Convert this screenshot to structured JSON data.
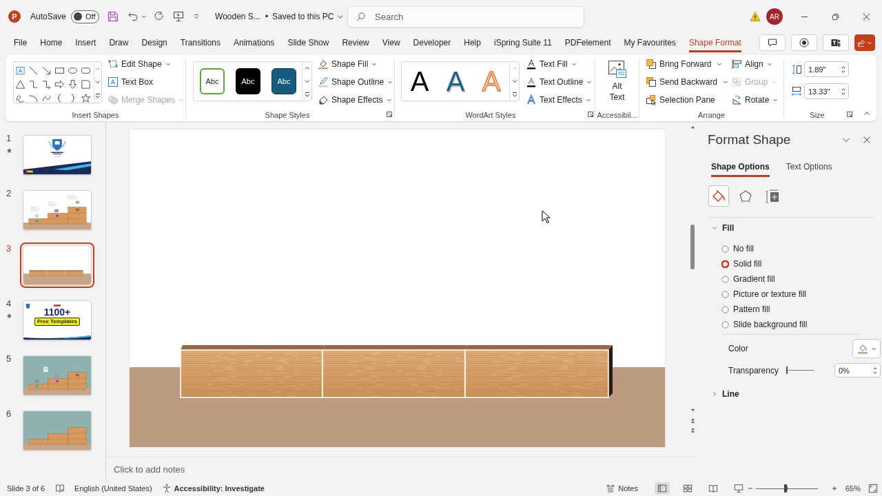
{
  "title_bar": {
    "app_logo": "P",
    "autosave": {
      "label": "AutoSave",
      "on": false,
      "state": "Off"
    },
    "document_name": "Wooden S...",
    "separator": "•",
    "save_status": "Saved to this PC",
    "search": {
      "placeholder": "Search"
    },
    "avatar": "AR"
  },
  "tabs": [
    {
      "label": "File",
      "selected": false
    },
    {
      "label": "Home",
      "selected": false
    },
    {
      "label": "Insert",
      "selected": false
    },
    {
      "label": "Draw",
      "selected": false
    },
    {
      "label": "Design",
      "selected": false
    },
    {
      "label": "Transitions",
      "selected": false
    },
    {
      "label": "Animations",
      "selected": false
    },
    {
      "label": "Slide Show",
      "selected": false
    },
    {
      "label": "Review",
      "selected": false
    },
    {
      "label": "View",
      "selected": false
    },
    {
      "label": "Developer",
      "selected": false
    },
    {
      "label": "Help",
      "selected": false
    },
    {
      "label": "iSpring Suite 11",
      "selected": false
    },
    {
      "label": "PDFelement",
      "selected": false
    },
    {
      "label": "My Favourites",
      "selected": false
    },
    {
      "label": "Shape Format",
      "selected": true
    }
  ],
  "ribbon": {
    "insert_shapes": {
      "label": "Insert Shapes",
      "commands": [
        {
          "label": "Edit Shape",
          "dropdown": true,
          "disabled": false
        },
        {
          "label": "Text Box",
          "dropdown": false,
          "disabled": false
        },
        {
          "label": "Merge Shapes",
          "dropdown": true,
          "disabled": true
        }
      ]
    },
    "shape_styles": {
      "label": "Shape Styles",
      "presets": [
        {
          "label": "Abc",
          "kind": "outline"
        },
        {
          "label": "Abc",
          "kind": "dark"
        },
        {
          "label": "Abc",
          "kind": "accent"
        }
      ],
      "commands": [
        {
          "label": "Shape Fill",
          "dropdown": true,
          "disabled": false
        },
        {
          "label": "Shape Outline",
          "dropdown": true,
          "disabled": false
        },
        {
          "label": "Shape Effects",
          "dropdown": true,
          "disabled": false
        }
      ]
    },
    "wordart_styles": {
      "label": "WordArt Styles",
      "presets": [
        {
          "label": "A",
          "kind": "plain"
        },
        {
          "label": "A",
          "kind": "shadow"
        },
        {
          "label": "A",
          "kind": "outline"
        }
      ],
      "commands": [
        {
          "label": "Text Fill",
          "dropdown": true,
          "disabled": false
        },
        {
          "label": "Text Outline",
          "dropdown": true,
          "disabled": false
        },
        {
          "label": "Text Effects",
          "dropdown": true,
          "disabled": false
        }
      ]
    },
    "accessibility": {
      "label": "Accessibil...",
      "command": "Alt Text"
    },
    "arrange": {
      "label": "Arrange",
      "commands": [
        {
          "label": "Bring Forward",
          "dropdown": true,
          "disabled": false
        },
        {
          "label": "Send Backward",
          "dropdown": true,
          "disabled": false
        },
        {
          "label": "Selection Pane",
          "dropdown": false,
          "disabled": false
        },
        {
          "label": "Align",
          "dropdown": true,
          "disabled": false
        },
        {
          "label": "Group",
          "dropdown": true,
          "disabled": true
        },
        {
          "label": "Rotate",
          "dropdown": true,
          "disabled": false
        }
      ]
    },
    "size": {
      "label": "Size",
      "height": "1.89\"",
      "width": "13.33\""
    }
  },
  "slides": [
    {
      "number": "1",
      "starred": true,
      "selected": false,
      "kind": "cover"
    },
    {
      "number": "2",
      "starred": false,
      "selected": false,
      "kind": "stairs"
    },
    {
      "number": "3",
      "starred": false,
      "selected": true,
      "kind": "floor"
    },
    {
      "number": "4",
      "starred": true,
      "selected": false,
      "kind": "promo",
      "heading": "1100+",
      "banner": "Free Templates"
    },
    {
      "number": "5",
      "starred": false,
      "selected": false,
      "kind": "stairs-teal"
    },
    {
      "number": "6",
      "starred": false,
      "selected": false,
      "kind": "stairs-teal-plain"
    }
  ],
  "notes": {
    "placeholder": "Click to add notes"
  },
  "format_pane": {
    "title": "Format Shape",
    "tabs": [
      {
        "label": "Shape Options",
        "selected": true
      },
      {
        "label": "Text Options",
        "selected": false
      }
    ],
    "categories": [
      {
        "selected": true
      },
      {
        "selected": false
      },
      {
        "selected": false
      }
    ],
    "fill": {
      "title": "Fill",
      "expanded": true,
      "options": [
        {
          "label": "No fill",
          "selected": false
        },
        {
          "label": "Solid fill",
          "selected": true
        },
        {
          "label": "Gradient fill",
          "selected": false
        },
        {
          "label": "Picture or texture fill",
          "selected": false
        },
        {
          "label": "Pattern fill",
          "selected": false
        },
        {
          "label": "Slide background fill",
          "selected": false
        }
      ],
      "color_label": "Color",
      "transparency": {
        "label": "Transparency",
        "level": 0,
        "value": "0%"
      }
    },
    "line": {
      "title": "Line",
      "expanded": false
    }
  },
  "status_bar": {
    "slide_counter": "Slide 3 of 6",
    "language": "English (United States)",
    "accessibility": "Accessibility: Investigate",
    "notes": "Notes",
    "views": [
      {
        "selected": true
      },
      {
        "selected": false
      },
      {
        "selected": false
      },
      {
        "selected": false
      }
    ],
    "zoom": {
      "level": 0.48,
      "value": "65%"
    }
  }
}
